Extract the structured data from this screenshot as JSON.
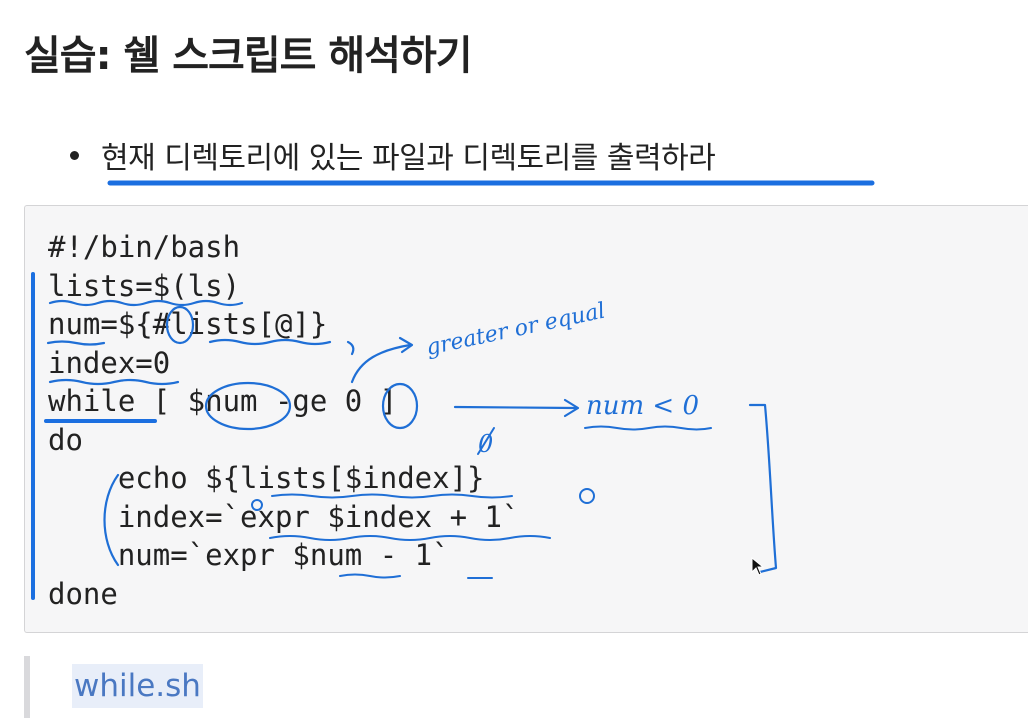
{
  "title": "실습: 쉘 스크립트 해석하기",
  "bullet": "현재 디렉토리에 있는 파일과 디렉토리를 출력하라",
  "code_lines": [
    "#!/bin/bash",
    "lists=$(ls)",
    "num=${#lists[@]}",
    "index=0",
    "while [ $num -ge 0 ]",
    "do",
    "    echo ${lists[$index]}",
    "    index=`expr $index + 1`",
    "    num=`expr $num - 1`",
    "done"
  ],
  "annotations": {
    "greater_or_equal": "greater or equal",
    "num_lt_zero": "num < 0",
    "zero_mark": "0"
  },
  "file_link": "while.sh",
  "colors": {
    "ink": "#1f6fd6",
    "underline": "#1b6fe0",
    "link": "#4a78c2"
  }
}
